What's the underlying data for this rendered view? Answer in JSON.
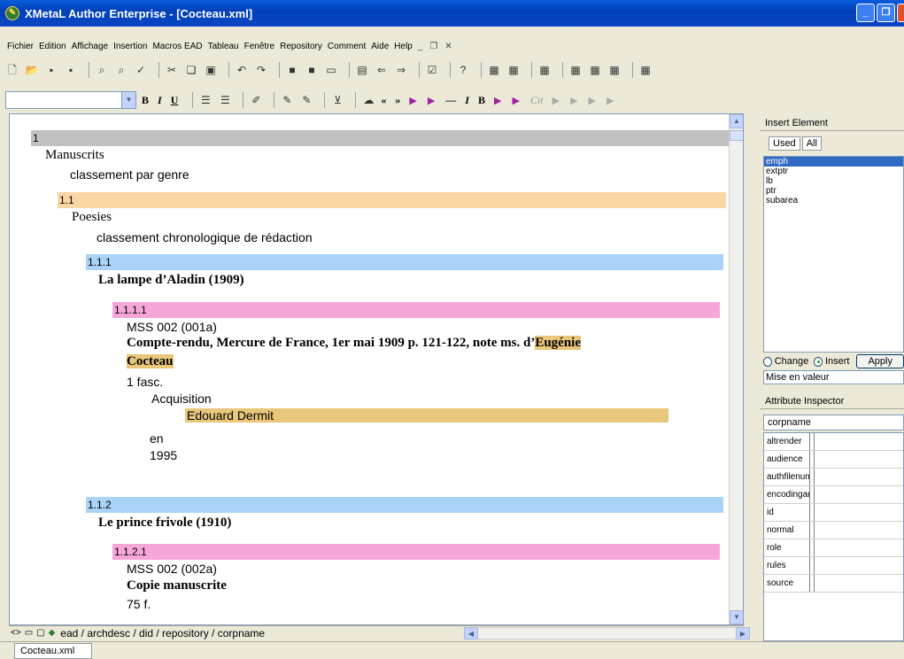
{
  "window": {
    "title": "XMetaL Author Enterprise - [Cocteau.xml]"
  },
  "menu": {
    "items": [
      "Fichier",
      "Edition",
      "Affichage",
      "Insertion",
      "Macros EAD",
      "Tableau",
      "Fenêtre",
      "Repository",
      "Comment",
      "Aide",
      "Help"
    ]
  },
  "document": {
    "sections": [
      {
        "number": "1",
        "heading": "Manuscrits",
        "note": "classement par genre"
      },
      {
        "number": "1.1",
        "heading": "Poesies",
        "note": "classement chronologique de rédaction"
      },
      {
        "number": "1.1.1",
        "heading": "La lampe d’Aladin (1909)"
      },
      {
        "number": "1.1.1.1",
        "ref": "MSS 002 (001a)",
        "title_part1": "Compte-rendu, Mercure de France, 1er mai 1909 p. 121-122, note ms. d’",
        "name_part1": "Eugénie",
        "name_part2": "Cocteau",
        "extent": "1 fasc.",
        "acq_label": "Acquisition",
        "acq_name": "Edouard Dermit",
        "acq_en": "en",
        "acq_year": "1995"
      },
      {
        "number": "1.1.2",
        "heading": "Le prince frivole (1910)"
      },
      {
        "number": "1.1.2.1",
        "ref": "MSS 002 (002a)",
        "title": "Copie manuscrite",
        "extent": "75 f."
      }
    ]
  },
  "status": {
    "path": "ead / archdesc / did / repository / corpname",
    "doc_tab": "Cocteau.xml"
  },
  "insert_element": {
    "title": "Insert Element",
    "tab_used": "Used",
    "tab_all": "All",
    "items": [
      "emph",
      "extptr",
      "lb",
      "ptr",
      "subarea"
    ],
    "selected": "emph",
    "change_label": "Change",
    "insert_label": "Insert",
    "apply_label": "Apply",
    "description": "Mise en valeur"
  },
  "attribute_inspector": {
    "title": "Attribute Inspector",
    "element": "corpname",
    "attributes": [
      "altrender",
      "audience",
      "authfilenumber",
      "encodinganalog",
      "id",
      "normal",
      "role",
      "rules",
      "source"
    ]
  },
  "colors": {
    "level1": "#C0C0C0",
    "level2": "#FAD6A5",
    "level3": "#AAD4F7",
    "level4": "#F6A6D8",
    "highlight": "#E8C67A"
  }
}
